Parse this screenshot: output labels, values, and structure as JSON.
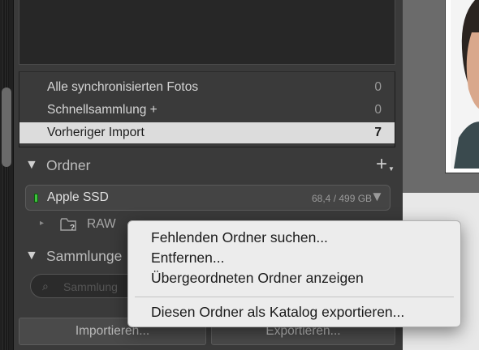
{
  "catalog": {
    "items": [
      {
        "label": "Alle synchronisierten Fotos",
        "count": "0"
      },
      {
        "label": "Schnellsammlung +",
        "count": "0"
      },
      {
        "label": "Vorheriger Import",
        "count": "7"
      }
    ]
  },
  "folders": {
    "title": "Ordner",
    "add_glyph": "+",
    "volume": {
      "name": "Apple SSD",
      "size": "68,4 / 499 GB",
      "status_color": "#3ec23e"
    },
    "folder": {
      "name": "RAW"
    }
  },
  "collections": {
    "title": "Sammlunge",
    "search_placeholder": "Sammlung"
  },
  "buttons": {
    "import": "Importieren...",
    "export": "Exportieren..."
  },
  "context_menu": {
    "items": [
      "Fehlenden Ordner suchen...",
      "Entfernen...",
      "Übergeordneten Ordner anzeigen",
      "Diesen Ordner als Katalog exportieren..."
    ]
  },
  "icons": {
    "expand_triangle": "▼",
    "disclosure": "▸",
    "folder": "folder-question-icon"
  }
}
